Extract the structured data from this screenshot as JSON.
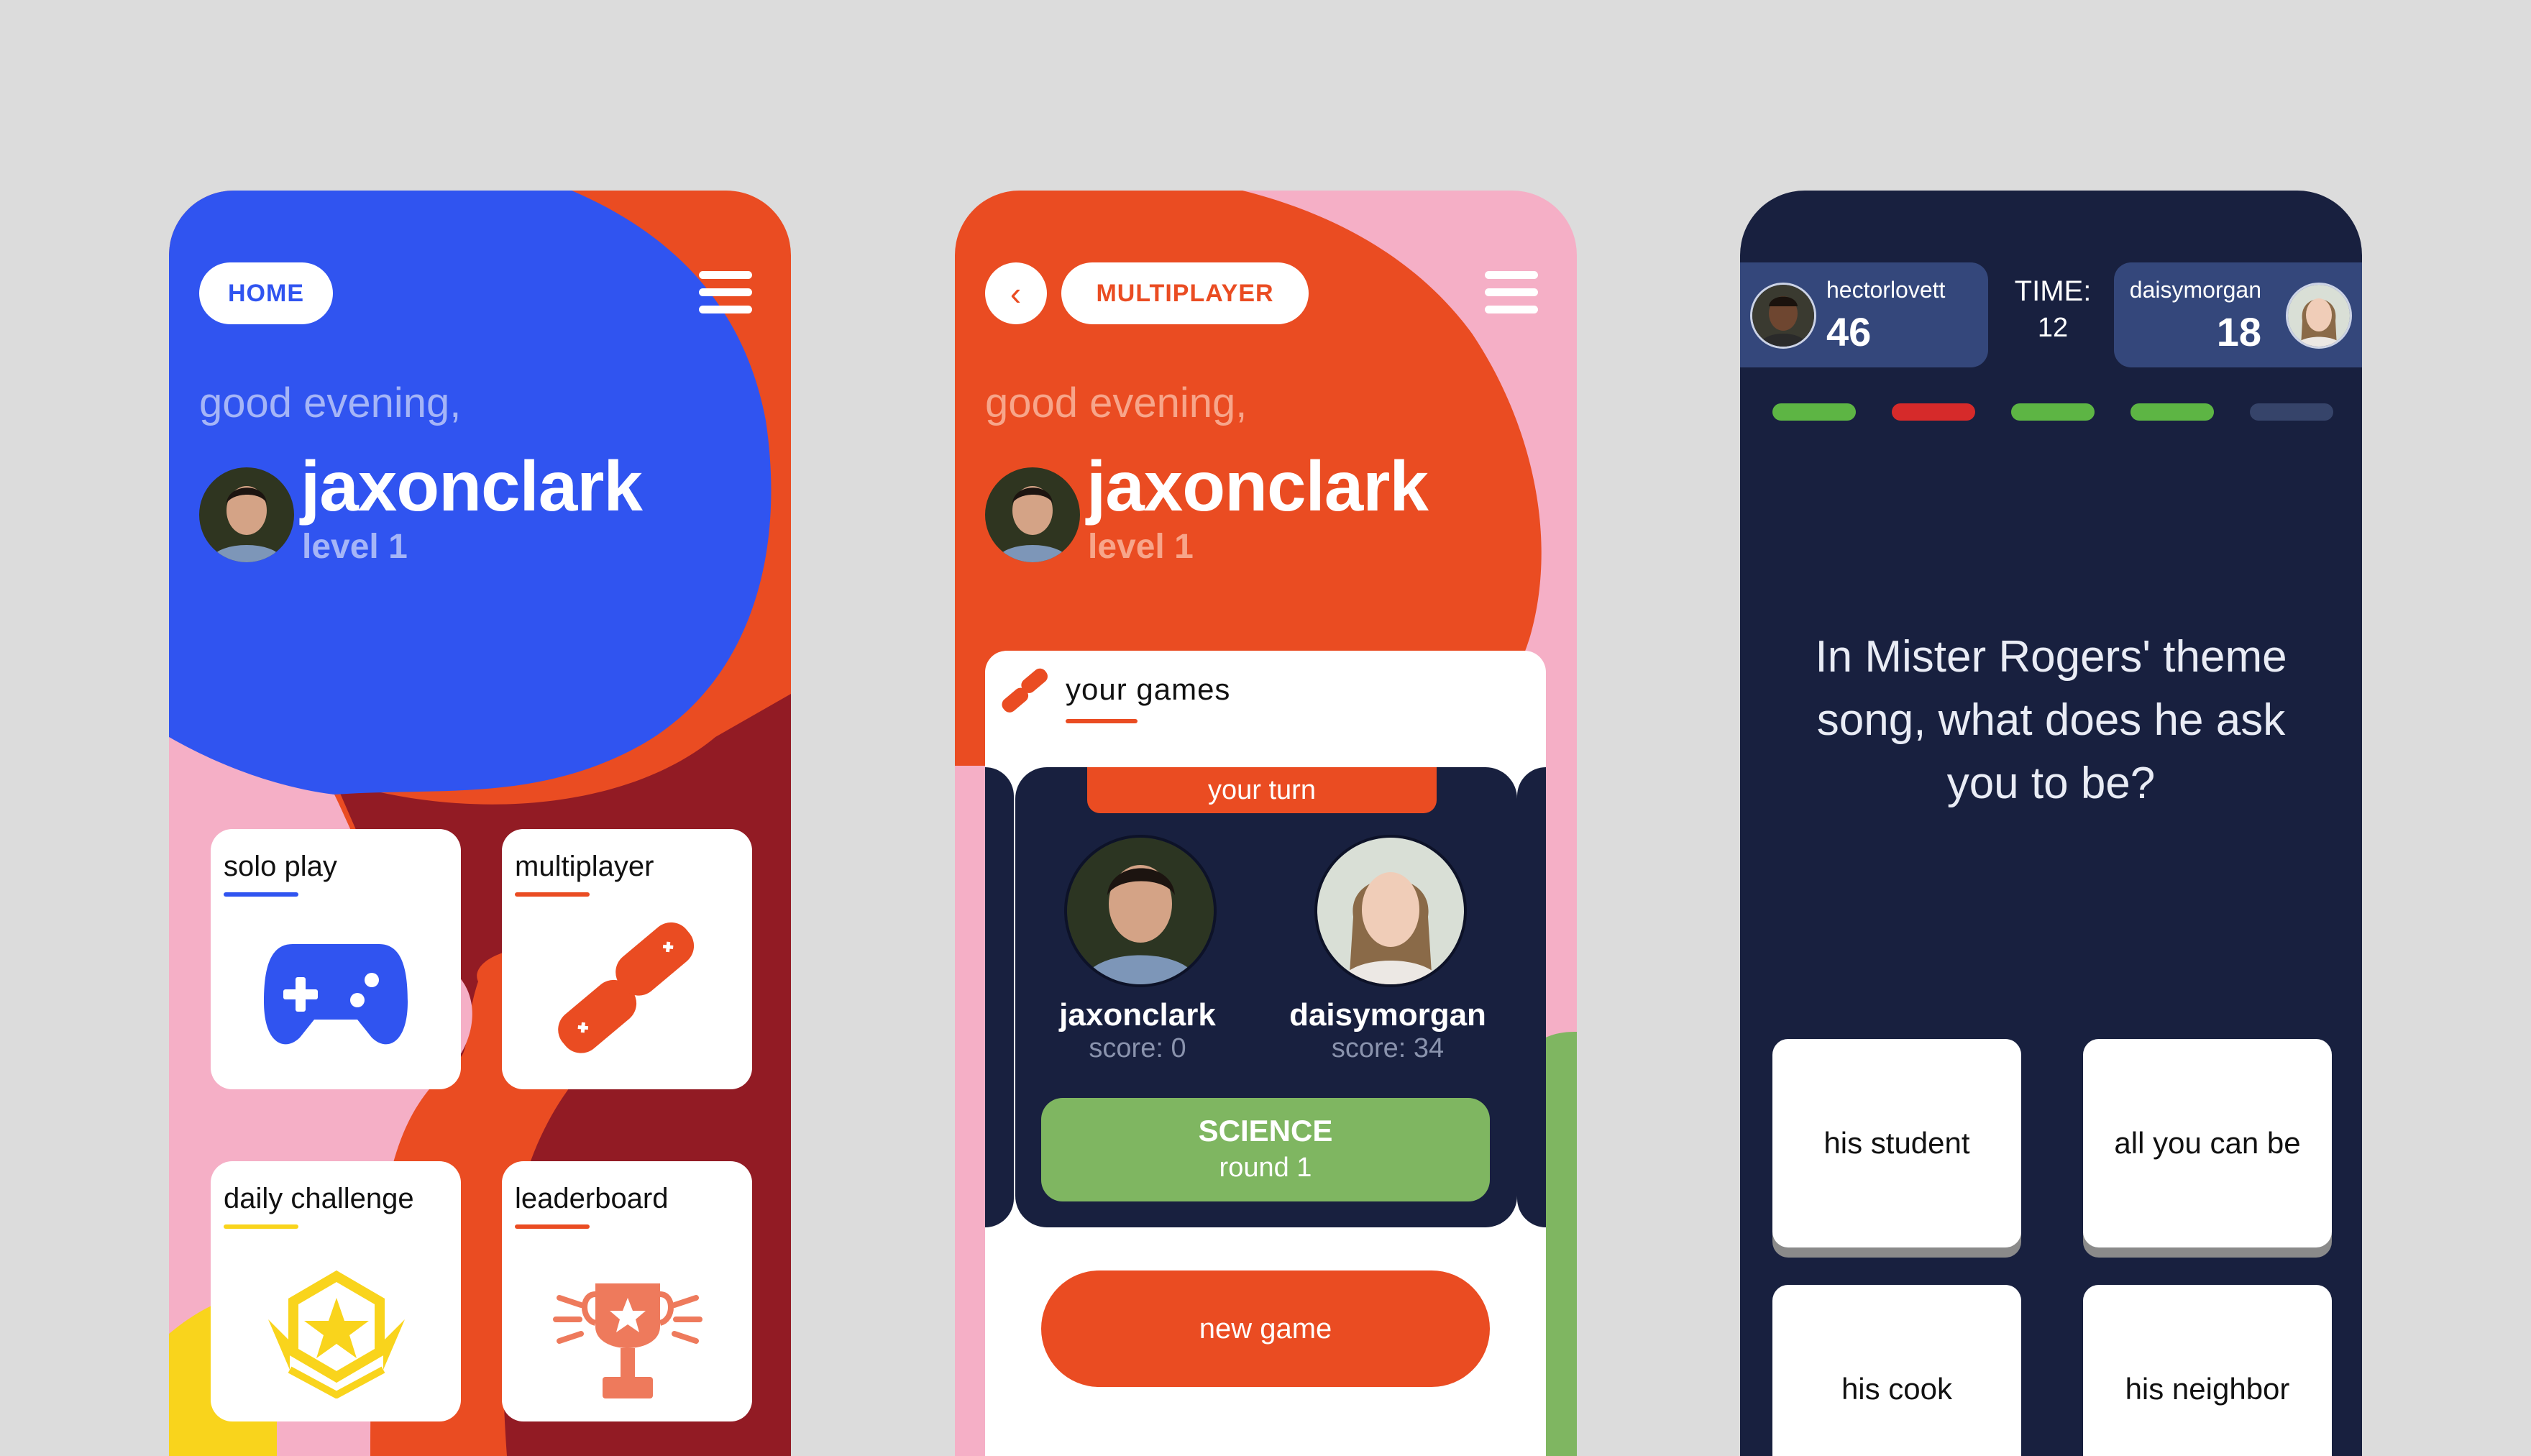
{
  "colors": {
    "blue": "#3054f0",
    "orange": "#ea4c22",
    "pink": "#f5afc6",
    "maroon": "#921b24",
    "navy": "#18203f",
    "green": "#7fb661",
    "yellow": "#f9d41c",
    "red": "#d62a2a"
  },
  "home": {
    "nav_label": "HOME",
    "greeting": "good evening,",
    "username": "jaxonclark",
    "level": "level 1",
    "cards": [
      {
        "title": "solo play",
        "icon": "gamepad-icon"
      },
      {
        "title": "multiplayer",
        "icon": "linked-controllers-icon"
      },
      {
        "title": "daily challenge",
        "icon": "star-badge-icon"
      },
      {
        "title": "leaderboard",
        "icon": "trophy-icon"
      }
    ]
  },
  "multiplayer": {
    "nav_label": "MULTIPLAYER",
    "greeting": "good evening,",
    "username": "jaxonclark",
    "level": "level 1",
    "section_title": "your games",
    "game": {
      "status": "your turn",
      "players": [
        {
          "name": "jaxonclark",
          "score": "score: 0"
        },
        {
          "name": "daisymorgan",
          "score": "score: 34"
        }
      ],
      "category": "SCIENCE",
      "round": "round 1"
    },
    "new_game_label": "new game"
  },
  "quiz": {
    "player_left": {
      "name": "hectorlovett",
      "score": "46"
    },
    "player_right": {
      "name": "daisymorgan",
      "score": "18"
    },
    "time_label": "TIME:",
    "time_value": "12",
    "progress": [
      "correct",
      "wrong",
      "correct",
      "correct",
      "pending"
    ],
    "question": "In Mister Rogers' theme song, what does he ask you to be?",
    "answers": [
      "his student",
      "all you can be",
      "his cook",
      "his neighbor"
    ]
  }
}
